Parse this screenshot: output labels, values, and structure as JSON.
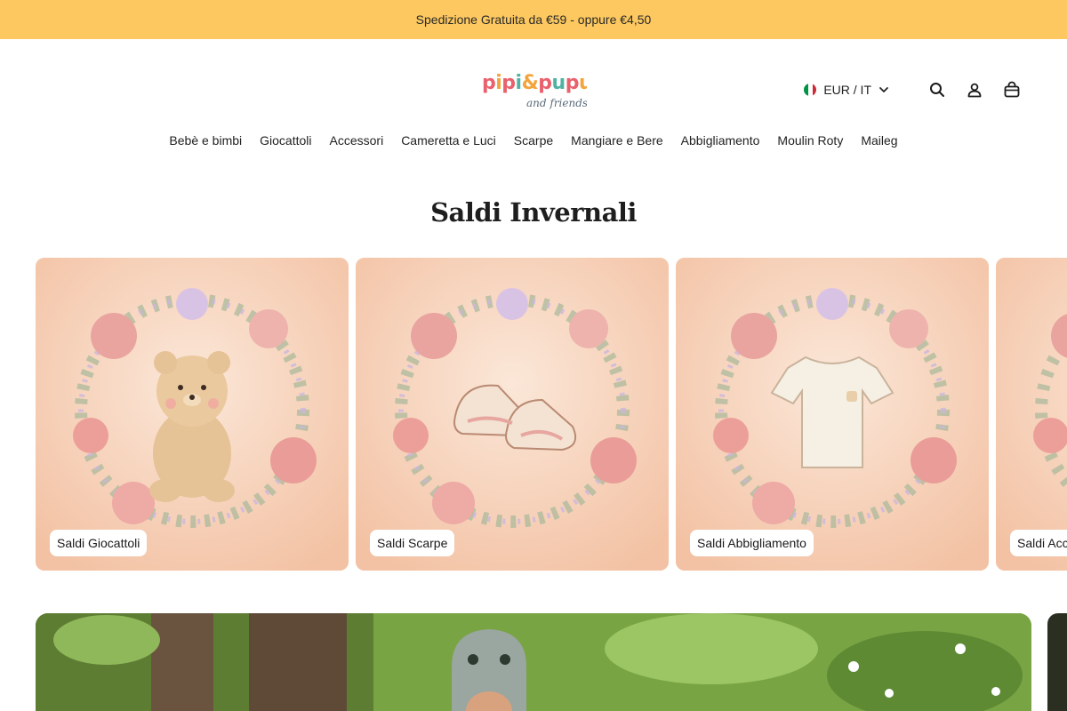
{
  "announcement": {
    "text": "Spedizione Gratuita da €59 - oppure €4,50"
  },
  "header": {
    "logo": {
      "primary": "pipi&pupu",
      "secondary": "and friends"
    },
    "locale": {
      "label": "EUR / IT",
      "flag": "italy-flag"
    },
    "icons": [
      "search-icon",
      "account-icon",
      "cart-icon"
    ]
  },
  "nav": {
    "items": [
      {
        "label": "Bebè e bimbi"
      },
      {
        "label": "Giocattoli"
      },
      {
        "label": "Accessori"
      },
      {
        "label": "Cameretta e Luci"
      },
      {
        "label": "Scarpe"
      },
      {
        "label": "Mangiare e Bere"
      },
      {
        "label": "Abbigliamento"
      },
      {
        "label": "Moulin Roty"
      },
      {
        "label": "Maileg"
      }
    ]
  },
  "section": {
    "title": "Saldi Invernali"
  },
  "cards": [
    {
      "label": "Saldi Giocattoli",
      "image": "teddy-bear-in-floral-wreath"
    },
    {
      "label": "Saldi Scarpe",
      "image": "baby-shoes-in-floral-wreath"
    },
    {
      "label": "Saldi Abbigliamento",
      "image": "tshirt-in-floral-wreath"
    },
    {
      "label": "Saldi Acc",
      "image": "floral-wreath"
    }
  ],
  "colors": {
    "announcement_bg": "#fdc85f",
    "card_bg": "#f6d5bf",
    "logo_pink": "#e8616d",
    "logo_orange": "#f3a43c",
    "logo_teal": "#4fb3a4"
  }
}
